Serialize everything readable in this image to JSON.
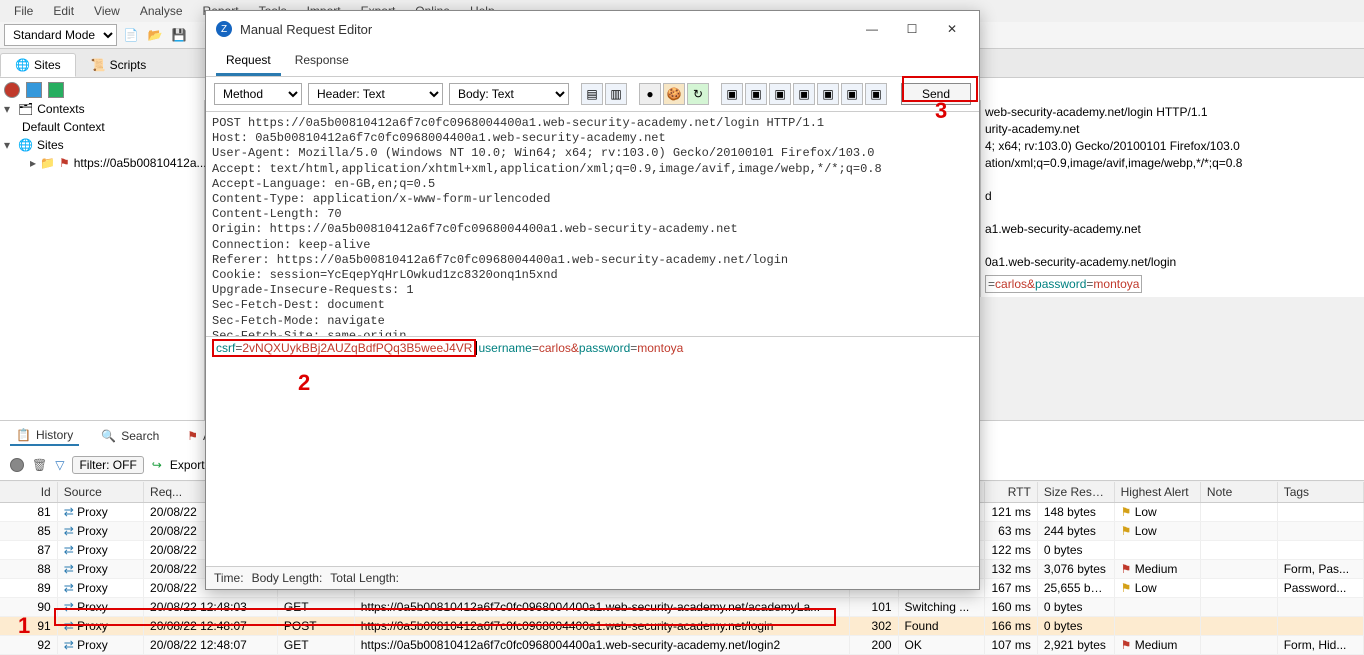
{
  "menu": {
    "file": "File",
    "edit": "Edit",
    "view": "View",
    "analyse": "Analyse",
    "report": "Report",
    "tools": "Tools",
    "import": "Import",
    "export": "Export",
    "online": "Online",
    "help": "Help"
  },
  "mode_label": "Standard Mode",
  "tabs": {
    "sites": "Sites",
    "scripts": "Scripts"
  },
  "tree": {
    "contexts": "Contexts",
    "default_ctx": "Default Context",
    "sites": "Sites",
    "site_url": "https://0a5b00810412a..."
  },
  "dialog": {
    "title": "Manual Request Editor",
    "tab_request": "Request",
    "tab_response": "Response",
    "method": "Method",
    "header": "Header: Text",
    "body": "Body: Text",
    "send": "Send",
    "headers_text": "POST https://0a5b00810412a6f7c0fc0968004400a1.web-security-academy.net/login HTTP/1.1\nHost: 0a5b00810412a6f7c0fc0968004400a1.web-security-academy.net\nUser-Agent: Mozilla/5.0 (Windows NT 10.0; Win64; x64; rv:103.0) Gecko/20100101 Firefox/103.0\nAccept: text/html,application/xhtml+xml,application/xml;q=0.9,image/avif,image/webp,*/*;q=0.8\nAccept-Language: en-GB,en;q=0.5\nContent-Type: application/x-www-form-urlencoded\nContent-Length: 70\nOrigin: https://0a5b00810412a6f7c0fc0968004400a1.web-security-academy.net\nConnection: keep-alive\nReferer: https://0a5b00810412a6f7c0fc0968004400a1.web-security-academy.net/login\nCookie: session=YcEqepYqHrLOwkud1zc8320onq1n5xnd\nUpgrade-Insecure-Requests: 1\nSec-Fetch-Dest: document\nSec-Fetch-Mode: navigate\nSec-Fetch-Site: same-origin",
    "csrf_key": "csrf",
    "csrf_val": "2vNQXUykBBj2AUZqBdfPQq3B5weeJ4VR",
    "user_key": "username",
    "user_val": "carlos",
    "pass_key": "password",
    "pass_val": "montoya",
    "status_time": "Time:",
    "status_bl": "Body Length:",
    "status_tl": "Total Length:"
  },
  "right_panel": {
    "l1": "web-security-academy.net/login HTTP/1.1",
    "l2": "urity-academy.net",
    "l3": "4; x64; rv:103.0) Gecko/20100101 Firefox/103.0",
    "l4": "ation/xml;q=0.9,image/avif,image/webp,*/*;q=0.8",
    "l5": "d",
    "l6": "a1.web-security-academy.net",
    "l7": "0a1.web-security-academy.net/login",
    "u_key": "",
    "u_val": "carlos",
    "p_key": "password",
    "p_val": "montoya"
  },
  "bottom_tabs": {
    "history": "History",
    "search": "Search",
    "alerts": "A..."
  },
  "filter": {
    "off": "Filter: OFF",
    "export": "Export"
  },
  "annotations": {
    "one": "1",
    "two": "2",
    "three": "3"
  },
  "hist_head": {
    "id": "Id",
    "source": "Source",
    "req": "Req...",
    "url": "",
    "code": "",
    "reason": "",
    "rtt": "RTT",
    "size": "Size Resp. ...",
    "alert": "Highest Alert",
    "note": "Note",
    "tags": "Tags"
  },
  "hist_rows": [
    {
      "id": "81",
      "src": "Proxy",
      "ts": "20/08/22",
      "method": "",
      "url": "",
      "code": "",
      "reason": "",
      "rtt": "121 ms",
      "sz": "148 bytes",
      "al": "Low",
      "alc": "y",
      "tags": ""
    },
    {
      "id": "85",
      "src": "Proxy",
      "ts": "20/08/22",
      "method": "",
      "url": "",
      "code": "",
      "reason": "",
      "rtt": "63 ms",
      "sz": "244 bytes",
      "al": "Low",
      "alc": "y",
      "tags": ""
    },
    {
      "id": "87",
      "src": "Proxy",
      "ts": "20/08/22",
      "method": "",
      "url": "",
      "code": "",
      "reason": "",
      "rtt": "122 ms",
      "sz": "0 bytes",
      "al": "",
      "alc": "",
      "tags": ""
    },
    {
      "id": "88",
      "src": "Proxy",
      "ts": "20/08/22",
      "method": "",
      "url": "",
      "code": "",
      "reason": "",
      "rtt": "132 ms",
      "sz": "3,076 bytes",
      "al": "Medium",
      "alc": "r",
      "tags": "Form, Pas..."
    },
    {
      "id": "89",
      "src": "Proxy",
      "ts": "20/08/22",
      "method": "",
      "url": "",
      "code": "",
      "reason": "",
      "rtt": "167 ms",
      "sz": "25,655 bytes",
      "al": "Low",
      "alc": "y",
      "tags": "Password..."
    },
    {
      "id": "90",
      "src": "Proxy",
      "ts": "20/08/22 12:48:03",
      "method": "GET",
      "url": "https://0a5b00810412a6f7c0fc0968004400a1.web-security-academy.net/academyLa...",
      "code": "101",
      "reason": "Switching ...",
      "rtt": "160 ms",
      "sz": "0 bytes",
      "al": "",
      "alc": "",
      "tags": ""
    },
    {
      "id": "91",
      "src": "Proxy",
      "ts": "20/08/22 12:48:07",
      "method": "POST",
      "url": "https://0a5b00810412a6f7c0fc0968004400a1.web-security-academy.net/login",
      "code": "302",
      "reason": "Found",
      "rtt": "166 ms",
      "sz": "0 bytes",
      "al": "",
      "alc": "",
      "tags": "",
      "sel": true
    },
    {
      "id": "92",
      "src": "Proxy",
      "ts": "20/08/22 12:48:07",
      "method": "GET",
      "url": "https://0a5b00810412a6f7c0fc0968004400a1.web-security-academy.net/login2",
      "code": "200",
      "reason": "OK",
      "rtt": "107 ms",
      "sz": "2,921 bytes",
      "al": "Medium",
      "alc": "r",
      "tags": "Form, Hid..."
    }
  ]
}
